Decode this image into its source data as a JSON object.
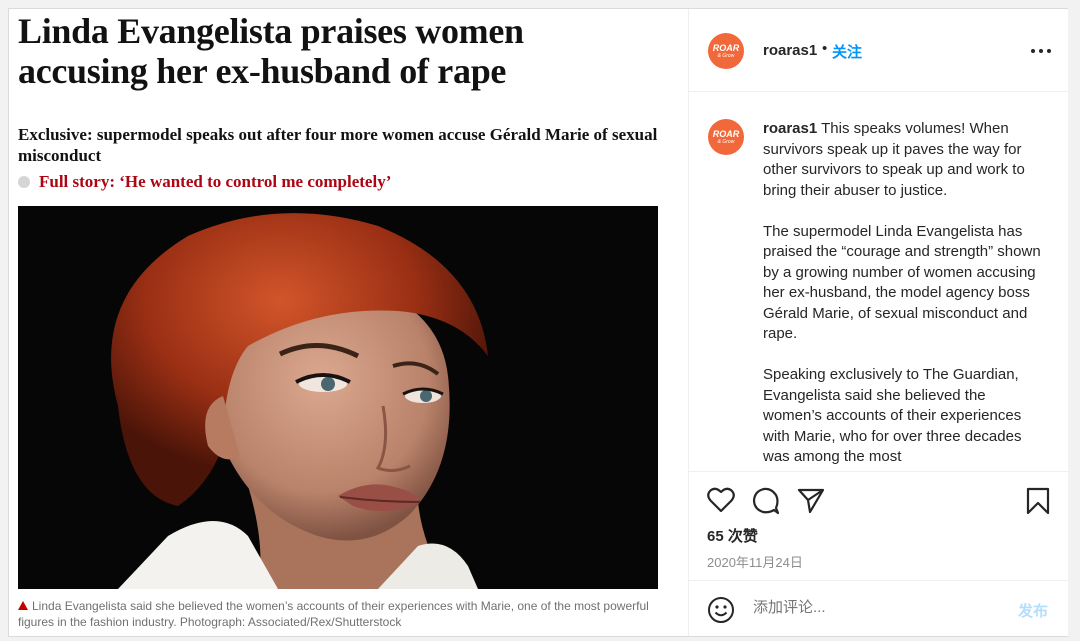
{
  "article": {
    "headline": "Linda Evangelista praises women accusing her ex-husband of rape",
    "subheadline": "Exclusive: supermodel speaks out after four more women accuse Gérald Marie of sexual misconduct",
    "full_story": "Full story: ‘He wanted to control me completely’",
    "photo_caption": "Linda Evangelista said she believed the women’s accounts of their experiences with Marie, one of the most powerful figures in the fashion industry. Photograph: Associated/Rex/Shutterstock"
  },
  "post": {
    "username": "roaras1",
    "separator": "•",
    "follow_label": "关注",
    "avatar_text": "ROAR",
    "avatar_subtext": "& Grow",
    "caption_user": "roaras1",
    "caption_paragraphs": [
      "This speaks volumes! When survivors speak up it paves the way for other survivors to speak up and work to bring their abuser to justice.",
      "The supermodel Linda Evangelista has praised the “courage and strength” shown by a growing number of women accusing her ex-husband, the model agency boss Gérald Marie, of sexual misconduct and rape.",
      "Speaking exclusively to The Guardian, Evangelista said she believed the women’s accounts of their experiences with Marie, who for over three decades was among the most"
    ],
    "likes": "65 次赞",
    "date": "2020年11月24日",
    "comment_placeholder": "添加评论...",
    "post_label": "发布"
  },
  "colors": {
    "follow": "#0095f6",
    "post_disabled": "#b2dffc",
    "avatar_bg": "#f1683a",
    "full_story": "#ab0613"
  },
  "icons": [
    "heart-icon",
    "comment-icon",
    "share-icon",
    "bookmark-icon",
    "more-icon",
    "emoji-icon",
    "alert-triangle-icon"
  ]
}
